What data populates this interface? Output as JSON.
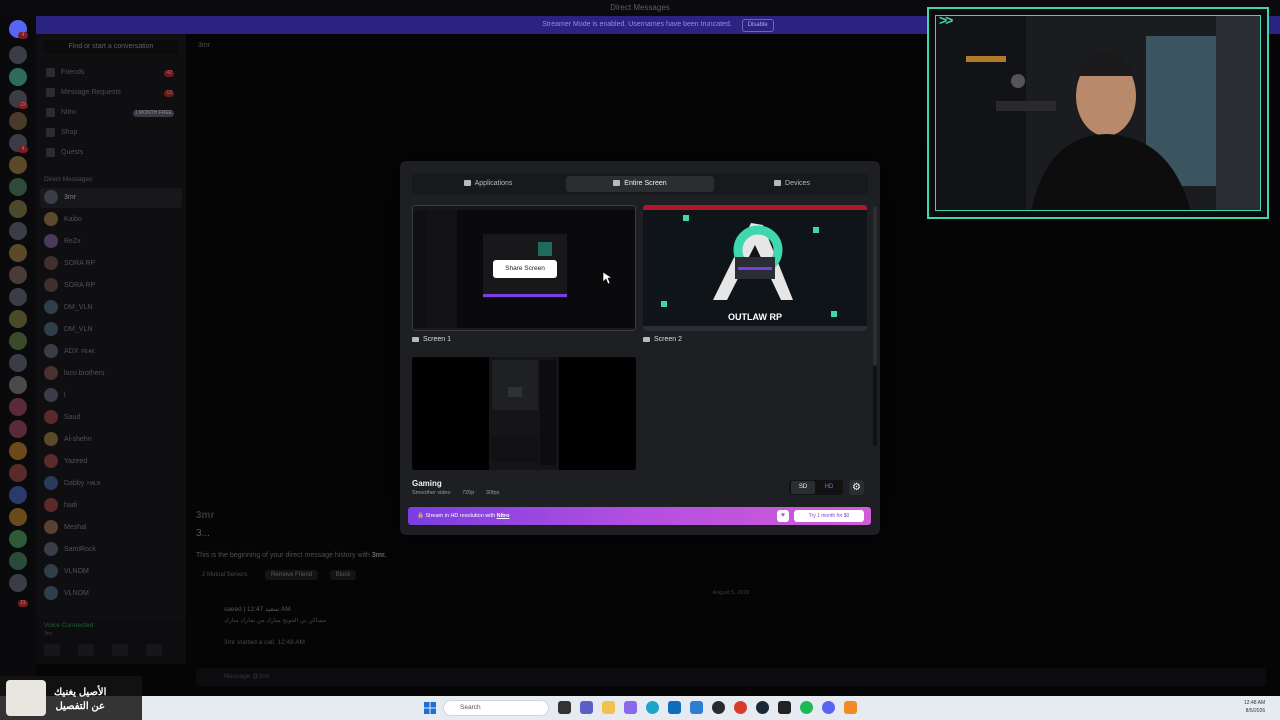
{
  "window": {
    "title": "Direct Messages"
  },
  "streamer_banner": {
    "text": "Streamer Mode is enabled. Usernames have been truncated.",
    "disable_label": "Disable"
  },
  "server_rail": {
    "badges": [
      "4",
      "22",
      "4",
      "11"
    ]
  },
  "sidebar": {
    "search_placeholder": "Find or start a conversation",
    "nav": [
      {
        "label": "Friends",
        "badge": "42"
      },
      {
        "label": "Message Requests",
        "badge": "13"
      },
      {
        "label": "Nitro",
        "badge": "1 MONTH FREE"
      },
      {
        "label": "Shop",
        "badge": ""
      },
      {
        "label": "Quests",
        "badge": ""
      }
    ],
    "dm_header": "Direct Messages",
    "dms": [
      {
        "name": "3mr",
        "tag": "",
        "color": "#3a3d45"
      },
      {
        "name": "Kaibo",
        "tag": "",
        "color": "#5b4a2f"
      },
      {
        "name": "ReZx",
        "tag": "",
        "color": "#4a3a5c"
      },
      {
        "name": "SORA RP",
        "tag": "",
        "color": "#3f2f2f"
      },
      {
        "name": "SORA RP",
        "tag": "",
        "color": "#3f2f2f"
      },
      {
        "name": "DM_VLN",
        "tag": "",
        "color": "#2f3f4a"
      },
      {
        "name": "DM_VLN",
        "tag": "",
        "color": "#2f3f4a"
      },
      {
        "name": "ADX",
        "tag": "PEAK",
        "color": "#3a3d45"
      },
      {
        "name": "loco brothers",
        "tag": "",
        "color": "#4a3030"
      },
      {
        "name": "l",
        "tag": "",
        "color": "#3a3d45"
      },
      {
        "name": "Saud",
        "tag": "",
        "color": "#5a2a2a"
      },
      {
        "name": "Al-shehri",
        "tag": "",
        "color": "#5a4a2a"
      },
      {
        "name": "Yazeed",
        "tag": "",
        "color": "#5a2a2a"
      },
      {
        "name": "Dabby",
        "tag": "HALB",
        "color": "#2a3a5a"
      },
      {
        "name": "hadi",
        "tag": "",
        "color": "#5a2a2a"
      },
      {
        "name": "Meshal",
        "tag": "",
        "color": "#5a4030"
      },
      {
        "name": "SamiRock",
        "tag": "",
        "color": "#3a3d45"
      },
      {
        "name": "VLNOM",
        "tag": "",
        "color": "#2f3f4a"
      },
      {
        "name": "VLNOM",
        "tag": "",
        "color": "#2f3f4a"
      }
    ],
    "voice": {
      "status": "Voice Connected",
      "sub": "3mr"
    }
  },
  "chat": {
    "header_name": "3mr",
    "big_name": "3mr",
    "big_sub": "3...",
    "beginning_prefix": "This is the beginning of your direct message history with ",
    "beginning_name": "3mr.",
    "mutual": "2 Mutual Servers",
    "remove_friend": "Remove Friend",
    "block": "Block",
    "date": "August 5, 2026",
    "msg_author": "saeed | سعيد",
    "msg_time": "12:47 AM",
    "msg_text": "مساكن بي التتويج مبارك من شارك مبارك",
    "call_author": "3mr",
    "call_text": "started a call.",
    "call_time": "12:48 AM",
    "input_placeholder": "Message @3mr"
  },
  "modal": {
    "tabs": [
      {
        "label": "Applications",
        "active": false
      },
      {
        "label": "Entire Screen",
        "active": true
      },
      {
        "label": "Devices",
        "active": false
      }
    ],
    "share_screen_label": "Share Screen",
    "screen1_label": "Screen 1",
    "screen2_label": "Screen 2",
    "screen2_text": "OUTLAW RP",
    "preset_title": "Gaming",
    "preset_desc": "Smoother video",
    "resolution": "720p",
    "framerate": "30fps",
    "sd_label": "SD",
    "hd_label": "HD",
    "nitro_text_prefix": "Stream in HD resolution with ",
    "nitro_link": "Nitro",
    "nitro_cta": "Try 1 month for $0"
  },
  "webcam": {
    "chevron": ">>"
  },
  "taskbar": {
    "search_placeholder": "Search",
    "time": "12:48 AM",
    "date": "8/5/2026"
  },
  "promo": {
    "line1": "الأصيل يغنيك",
    "line2": "عن التفصيل"
  },
  "colors": {
    "accent": "#3fd6b0",
    "nitro_start": "#7a3fe0",
    "nitro_end": "#d05dd7",
    "modal_bg": "#1e1f22"
  }
}
